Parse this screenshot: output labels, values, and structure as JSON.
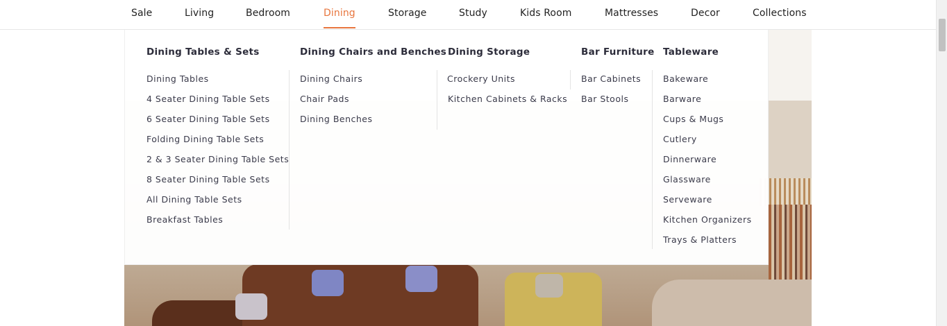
{
  "nav": {
    "items": [
      {
        "label": "Sale"
      },
      {
        "label": "Living"
      },
      {
        "label": "Bedroom"
      },
      {
        "label": "Dining"
      },
      {
        "label": "Storage"
      },
      {
        "label": "Study"
      },
      {
        "label": "Kids Room"
      },
      {
        "label": "Mattresses"
      },
      {
        "label": "Decor"
      },
      {
        "label": "Collections"
      }
    ],
    "active": "Dining",
    "active_color": "#e8763e"
  },
  "mega_menu": {
    "columns": [
      {
        "title": "Dining Tables & Sets",
        "links": [
          "Dining Tables",
          "4 Seater Dining Table Sets",
          "6 Seater Dining Table Sets",
          "Folding Dining Table Sets",
          "2 & 3 Seater Dining Table Sets",
          "8 Seater Dining Table Sets",
          "All Dining Table Sets",
          "Breakfast Tables"
        ]
      },
      {
        "title": "Dining Chairs and Benches",
        "links": [
          "Dining Chairs",
          "Chair Pads",
          "Dining Benches"
        ]
      },
      {
        "title": "Dining Storage",
        "links": [
          "Crockery Units",
          "Kitchen Cabinets & Racks"
        ]
      },
      {
        "title": "Bar Furniture",
        "links": [
          "Bar Cabinets",
          "Bar Stools"
        ]
      },
      {
        "title": "Tableware",
        "links": [
          "Bakeware",
          "Barware",
          "Cups & Mugs",
          "Cutlery",
          "Dinnerware",
          "Glassware",
          "Serveware",
          "Kitchen Organizers",
          "Trays & Platters"
        ]
      }
    ]
  }
}
